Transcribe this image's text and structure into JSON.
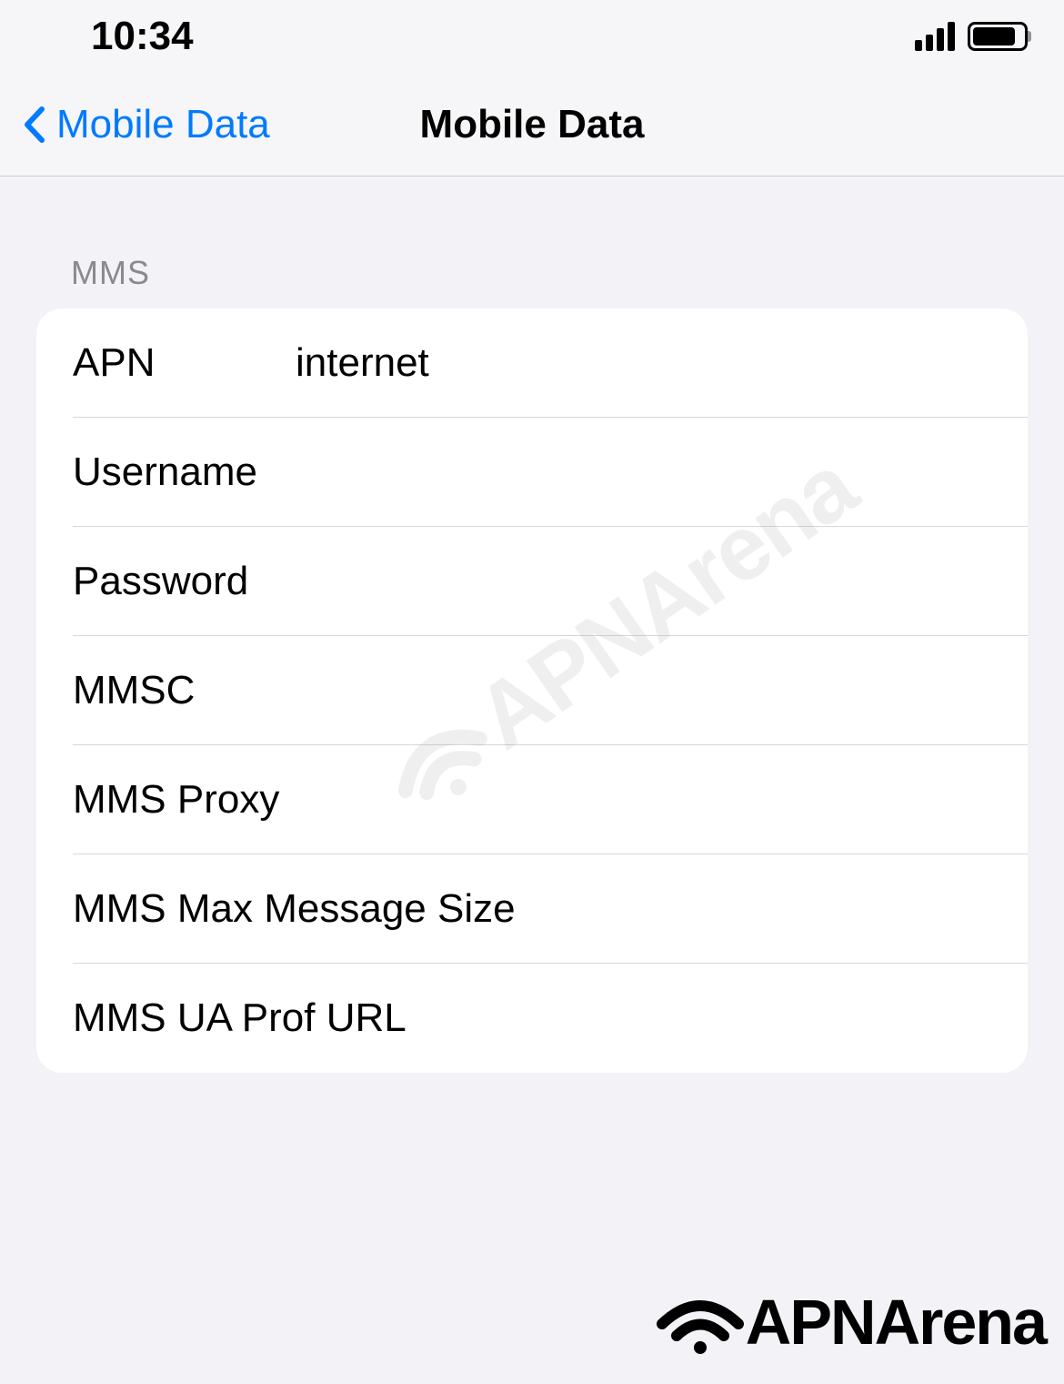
{
  "statusBar": {
    "time": "10:34"
  },
  "nav": {
    "backLabel": "Mobile Data",
    "title": "Mobile Data"
  },
  "section": {
    "header": "MMS"
  },
  "fields": {
    "apn": {
      "label": "APN",
      "value": "internet"
    },
    "username": {
      "label": "Username",
      "value": ""
    },
    "password": {
      "label": "Password",
      "value": ""
    },
    "mmsc": {
      "label": "MMSC",
      "value": ""
    },
    "mmsProxy": {
      "label": "MMS Proxy",
      "value": ""
    },
    "mmsMaxSize": {
      "label": "MMS Max Message Size",
      "value": ""
    },
    "mmsUaProf": {
      "label": "MMS UA Prof URL",
      "value": ""
    }
  },
  "watermark": "APNArena",
  "brand": "APNArena"
}
